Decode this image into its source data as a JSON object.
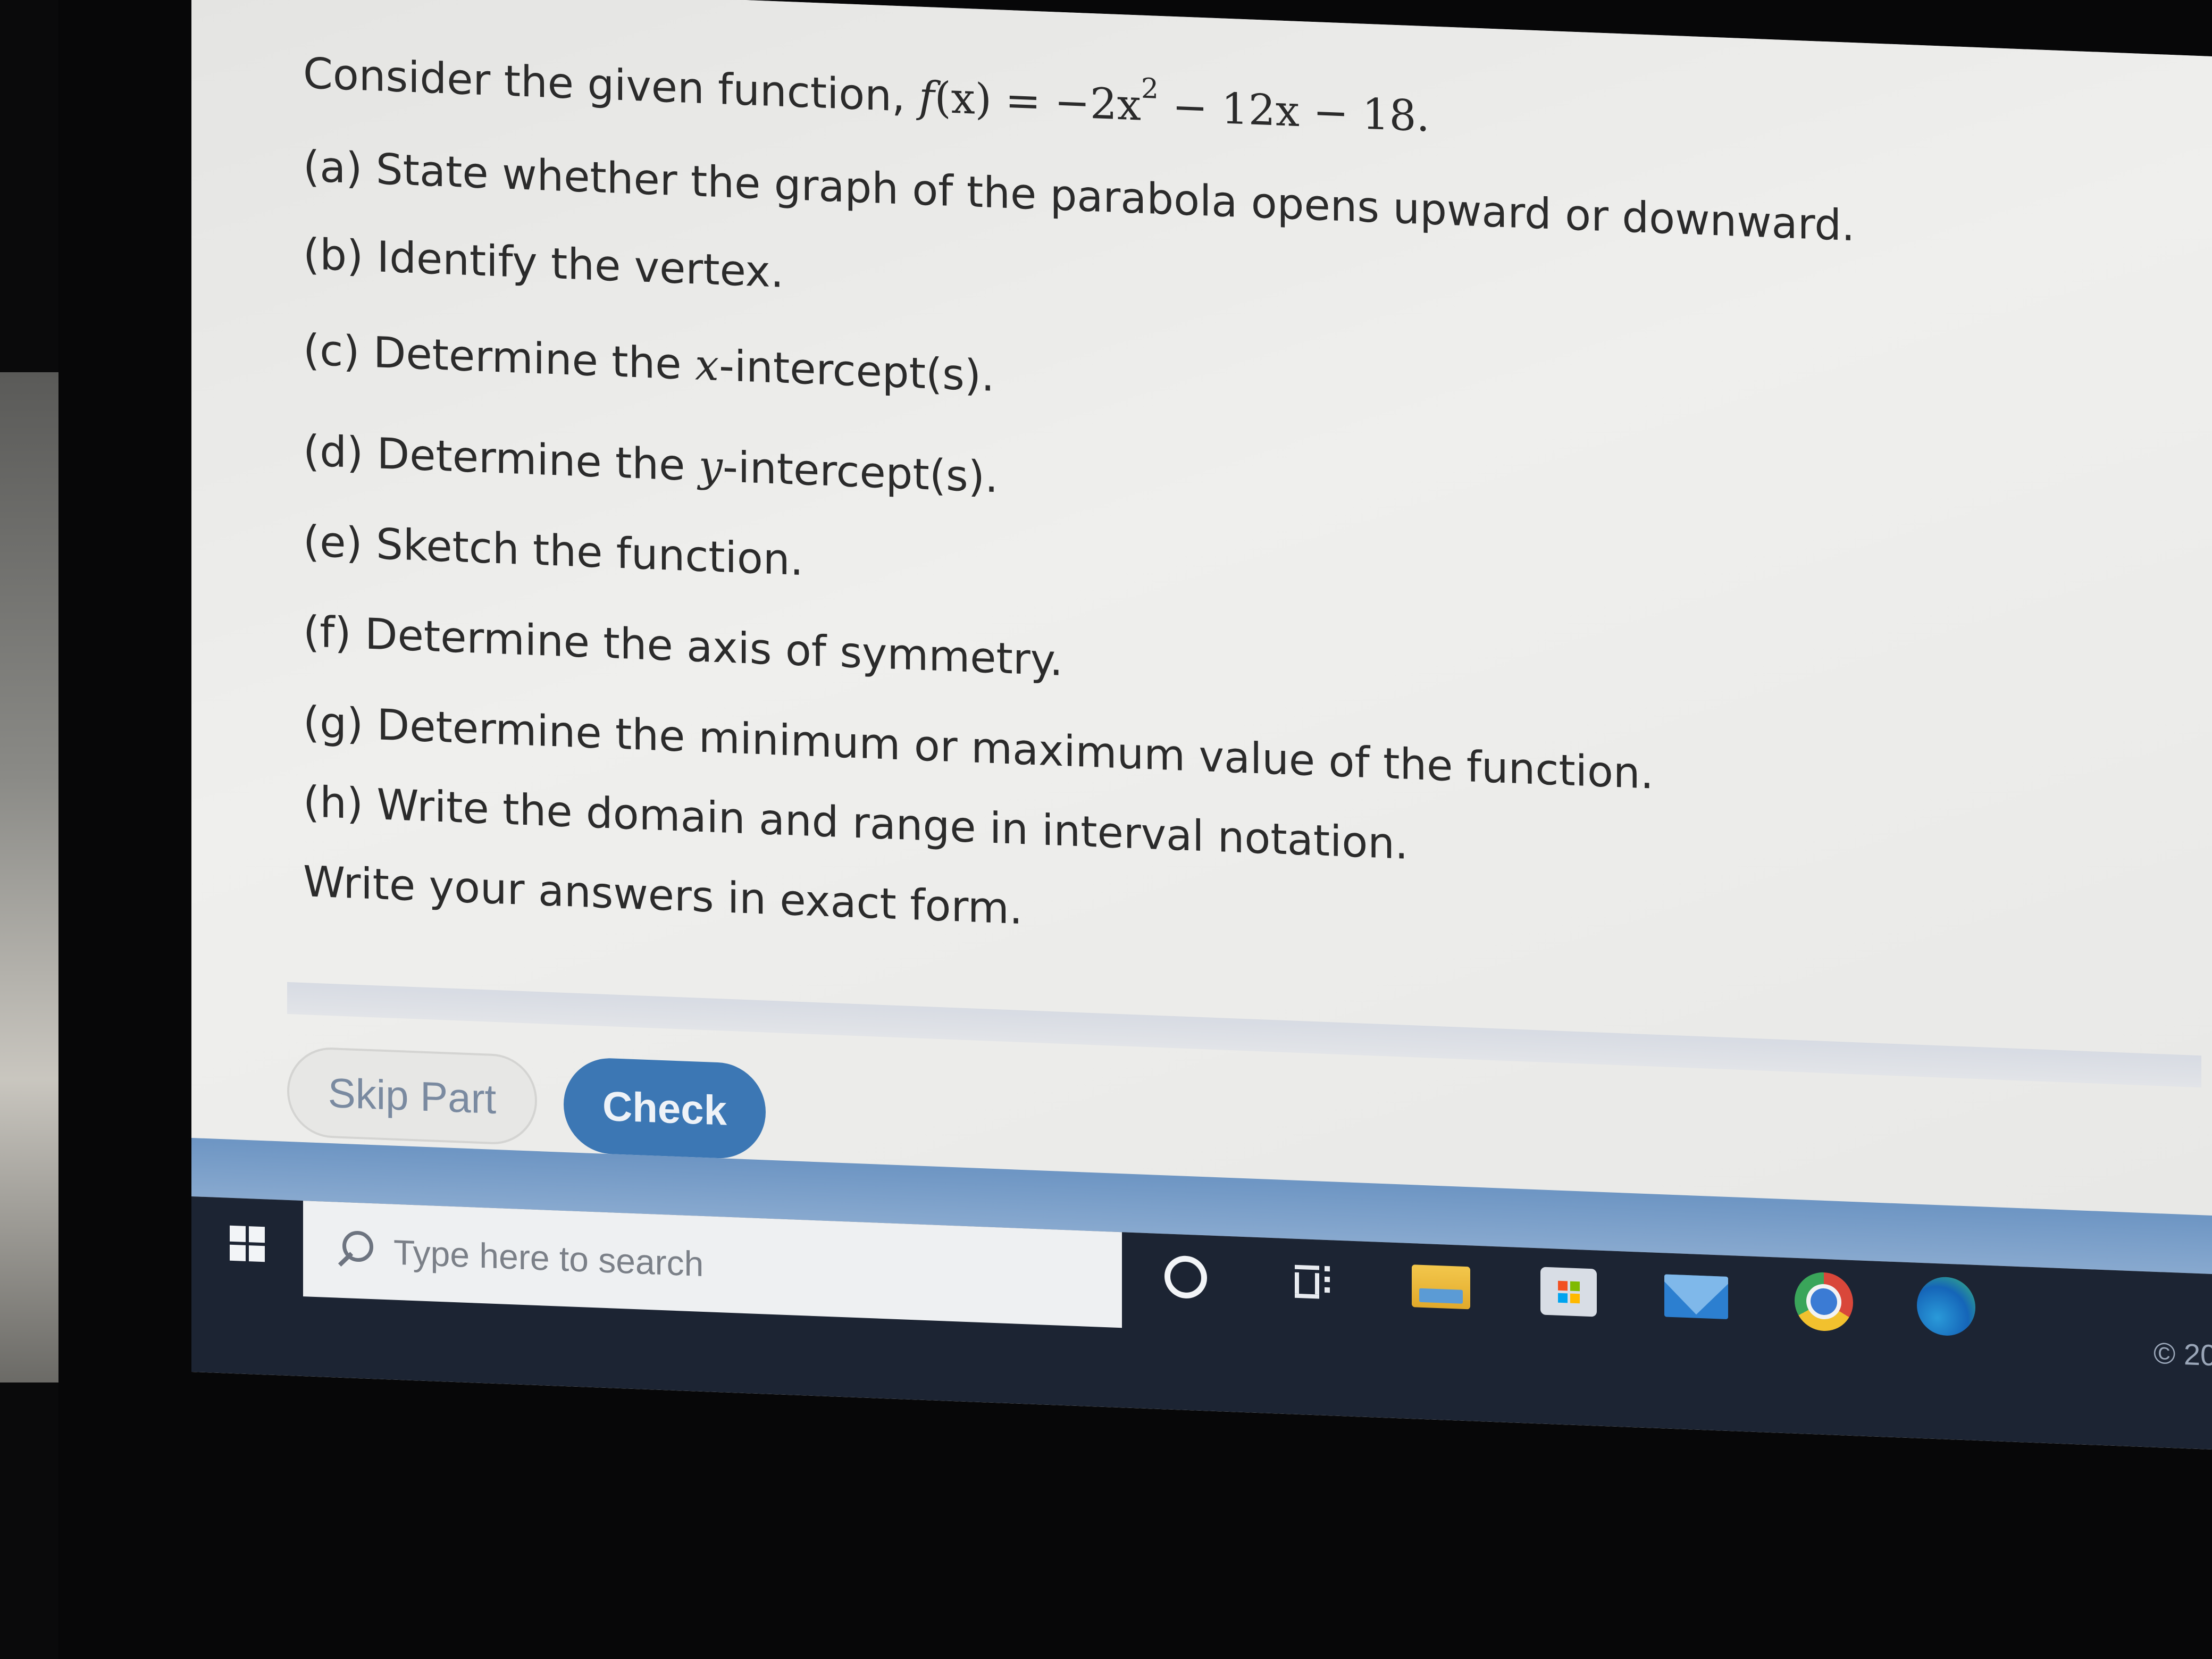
{
  "question": {
    "intro_text": "Consider the given function,",
    "function_name": "f",
    "function_var": "(x)",
    "equals": " = −2x",
    "exponent": "2",
    "rest": " − 12x − 18.",
    "parts": [
      {
        "label": "(a) State whether the graph of the parabola opens upward or downward."
      },
      {
        "label": "(b) Identify the vertex."
      },
      {
        "label_pre": "(c) Determine the ",
        "var": "x",
        "label_post": "-intercept(s)."
      },
      {
        "label_pre": "(d) Determine the ",
        "var": "y",
        "label_post": "-intercept(s)."
      },
      {
        "label": "(e) Sketch the function."
      },
      {
        "label": "(f) Determine the axis of symmetry."
      },
      {
        "label": "(g) Determine the minimum or maximum value of the function."
      },
      {
        "label": "(h) Write the domain and range in interval notation."
      }
    ],
    "instruction": "Write your answers in exact form."
  },
  "buttons": {
    "skip_label": "Skip Part",
    "check_label": "Check"
  },
  "taskbar": {
    "search_placeholder": "Type here to search",
    "icons": [
      "windows-start-icon",
      "search-icon",
      "cortana-icon",
      "task-view-icon",
      "file-explorer-icon",
      "microsoft-store-icon",
      "mail-icon",
      "chrome-icon",
      "edge-icon"
    ],
    "tray_text": "© 20"
  }
}
